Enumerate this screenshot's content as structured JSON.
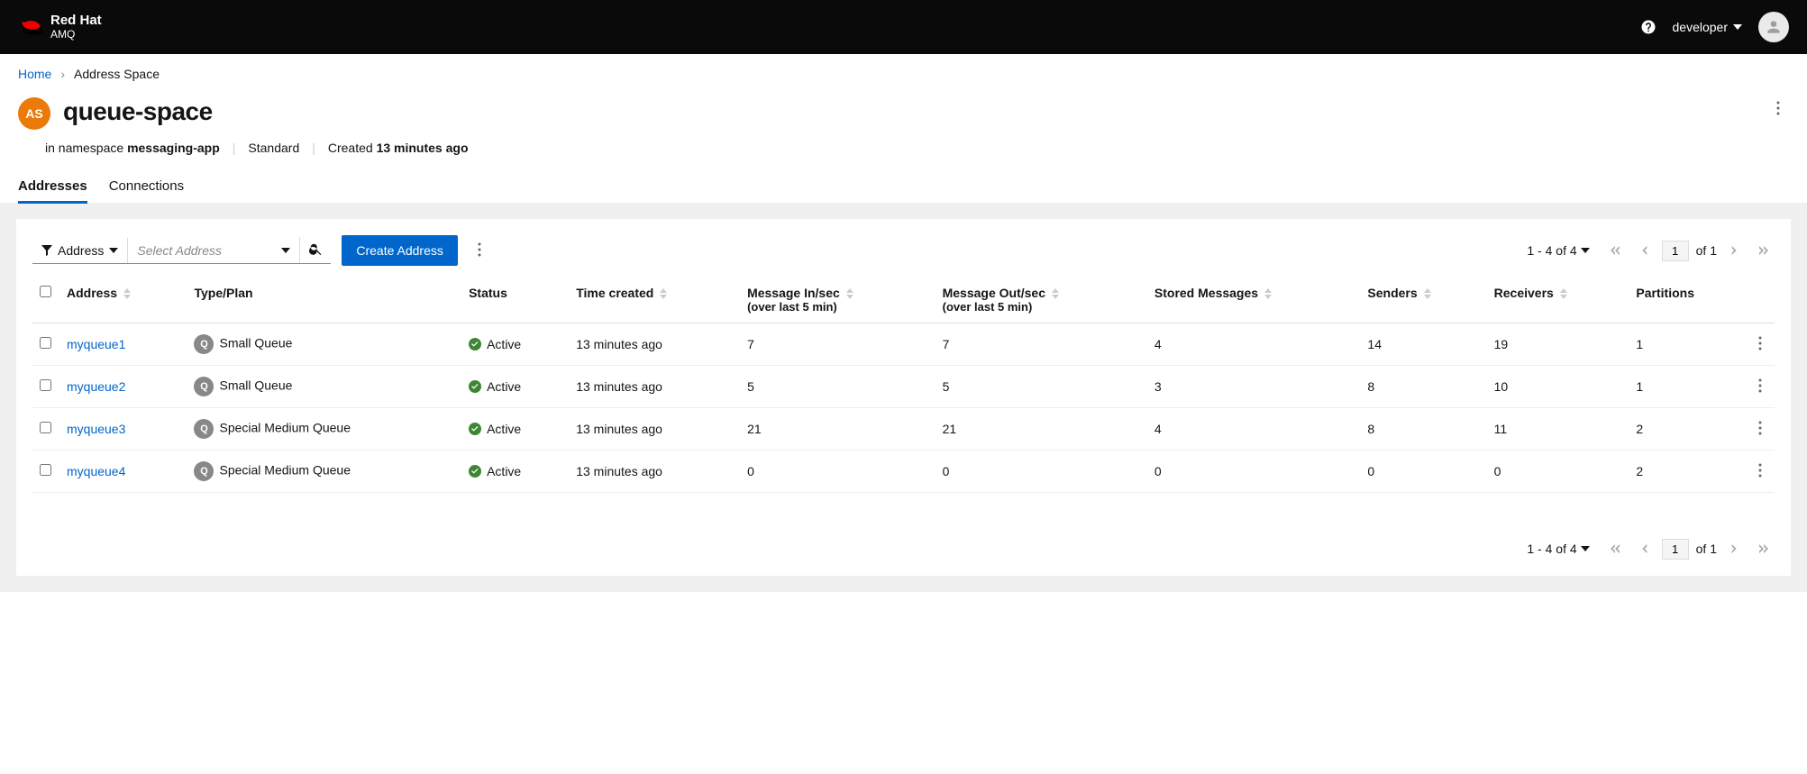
{
  "header": {
    "brand_main": "Red Hat",
    "brand_sub": "AMQ",
    "username": "developer"
  },
  "breadcrumb": {
    "home": "Home",
    "current": "Address Space"
  },
  "title": {
    "badge": "AS",
    "name": "queue-space"
  },
  "meta": {
    "namespace_prefix": "in namespace ",
    "namespace": "messaging-app",
    "type": "Standard",
    "created_prefix": "Created ",
    "created": "13 minutes ago"
  },
  "tabs": {
    "addresses": "Addresses",
    "connections": "Connections"
  },
  "toolbar": {
    "filter_label": "Address",
    "filter_placeholder": "Select Address",
    "create_btn": "Create Address"
  },
  "pagination": {
    "summary": "1 - 4 of 4",
    "page": "1",
    "of_label": "of 1"
  },
  "columns": {
    "address": "Address",
    "type_plan": "Type/Plan",
    "status": "Status",
    "time_created": "Time created",
    "msg_in": "Message In/sec",
    "msg_in_sub": "(over last 5 min)",
    "msg_out": "Message Out/sec",
    "msg_out_sub": "(over last 5 min)",
    "stored": "Stored Messages",
    "senders": "Senders",
    "receivers": "Receivers",
    "partitions": "Partitions"
  },
  "rows": [
    {
      "name": "myqueue1",
      "type_badge": "Q",
      "plan": "Small Queue",
      "status": "Active",
      "time": "13 minutes ago",
      "msg_in": "7",
      "msg_out": "7",
      "stored": "4",
      "senders": "14",
      "receivers": "19",
      "partitions": "1"
    },
    {
      "name": "myqueue2",
      "type_badge": "Q",
      "plan": "Small Queue",
      "status": "Active",
      "time": "13 minutes ago",
      "msg_in": "5",
      "msg_out": "5",
      "stored": "3",
      "senders": "8",
      "receivers": "10",
      "partitions": "1"
    },
    {
      "name": "myqueue3",
      "type_badge": "Q",
      "plan": "Special Medium Queue",
      "status": "Active",
      "time": "13 minutes ago",
      "msg_in": "21",
      "msg_out": "21",
      "stored": "4",
      "senders": "8",
      "receivers": "11",
      "partitions": "2"
    },
    {
      "name": "myqueue4",
      "type_badge": "Q",
      "plan": "Special Medium Queue",
      "status": "Active",
      "time": "13 minutes ago",
      "msg_in": "0",
      "msg_out": "0",
      "stored": "0",
      "senders": "0",
      "receivers": "0",
      "partitions": "2"
    }
  ]
}
